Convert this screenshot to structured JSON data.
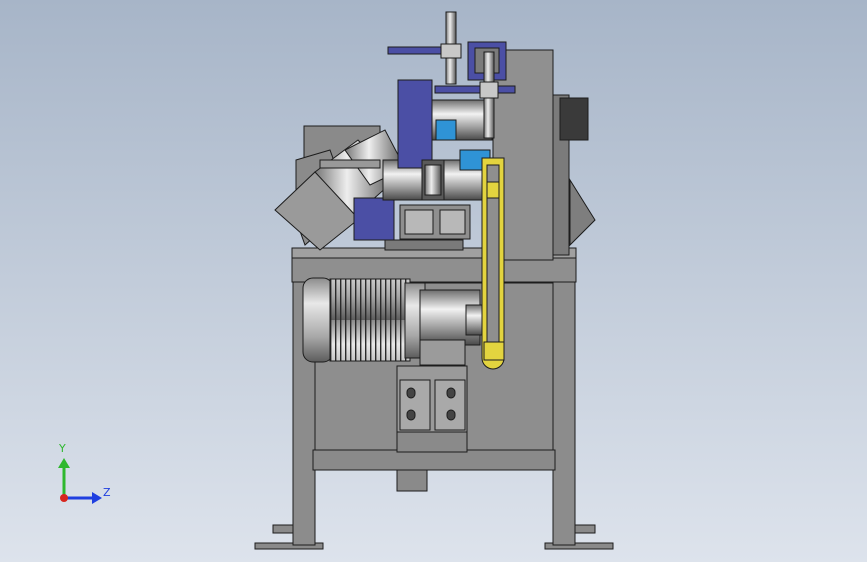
{
  "colors": {
    "background_top": "#a7b5c8",
    "background_bottom": "#dde3ec",
    "frame": "#8a8a8a",
    "frame_dark": "#6d6d6d",
    "outline": "#1c1c1c",
    "motor": "#b8b8b8",
    "handle": "#4b4fa5",
    "belt": "#e3d43f",
    "accent_blue": "#2f93d6",
    "triad_x": "#d7261e",
    "triad_y": "#2eb82e",
    "triad_z": "#1f3fe0",
    "label_color": "#1f3fe0"
  },
  "triad": {
    "y_label": "Y",
    "z_label": "Z"
  }
}
